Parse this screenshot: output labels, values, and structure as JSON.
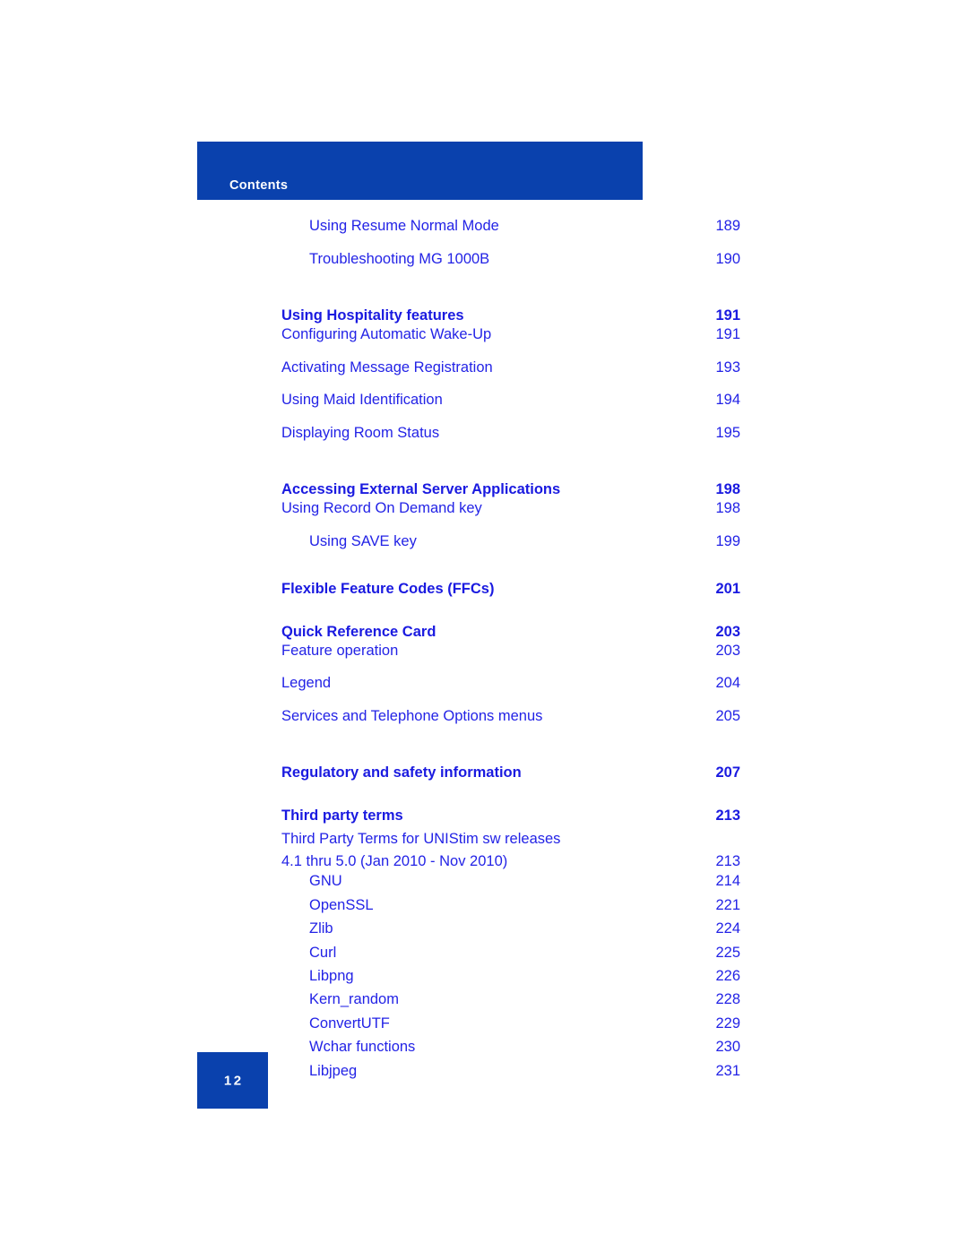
{
  "header": {
    "title": "Contents",
    "band_color": "#0a41ad"
  },
  "colors": {
    "band": "#0a41ad",
    "heading_text": "#1a1ae0",
    "entry_text": "#2323e6",
    "page_background": "#ffffff"
  },
  "footer": {
    "page_number": "12"
  },
  "toc": {
    "entries": [
      {
        "level": 3,
        "label": "Using Resume Normal Mode",
        "page": "189"
      },
      {
        "level": 3,
        "label": "Troubleshooting MG 1000B",
        "page": "190"
      },
      {
        "level": 1,
        "label": "Using Hospitality features",
        "page": "191"
      },
      {
        "level": 2,
        "label": "Configuring Automatic Wake-Up",
        "page": "191"
      },
      {
        "level": 2,
        "label": "Activating Message Registration",
        "page": "193"
      },
      {
        "level": 2,
        "label": "Using Maid Identification",
        "page": "194"
      },
      {
        "level": 2,
        "label": "Displaying Room Status",
        "page": "195"
      },
      {
        "level": 1,
        "label": "Accessing External Server Applications",
        "page": "198"
      },
      {
        "level": 2,
        "label": "Using Record On Demand key",
        "page": "198"
      },
      {
        "level": 3,
        "label": "Using SAVE key",
        "page": "199"
      },
      {
        "level": 1,
        "label": "Flexible Feature Codes (FFCs)",
        "page": "201"
      },
      {
        "level": 1,
        "label": "Quick Reference Card",
        "page": "203"
      },
      {
        "level": 2,
        "label": "Feature operation",
        "page": "203"
      },
      {
        "level": 2,
        "label": "Legend",
        "page": "204"
      },
      {
        "level": 2,
        "label": "Services and Telephone Options menus",
        "page": "205"
      },
      {
        "level": 1,
        "label": "Regulatory and safety information",
        "page": "207"
      },
      {
        "level": 1,
        "label": "Third party terms",
        "page": "213"
      },
      {
        "level": 2,
        "wrapped": true,
        "label_line1": "Third Party Terms for UNIStim sw releases",
        "label_line2": "4.1 thru 5.0 (Jan 2010 - Nov 2010)",
        "page": "213"
      },
      {
        "level": 3,
        "label": "GNU",
        "page": "214"
      },
      {
        "level": 3,
        "label": "OpenSSL",
        "page": "221"
      },
      {
        "level": 3,
        "label": "Zlib",
        "page": "224"
      },
      {
        "level": 3,
        "label": "Curl",
        "page": "225"
      },
      {
        "level": 3,
        "label": "Libpng",
        "page": "226"
      },
      {
        "level": 3,
        "label": "Kern_random",
        "page": "228"
      },
      {
        "level": 3,
        "label": "ConvertUTF",
        "page": "229"
      },
      {
        "level": 3,
        "label": "Wchar functions",
        "page": "230"
      },
      {
        "level": 3,
        "label": "Libjpeg",
        "page": "231"
      }
    ]
  }
}
